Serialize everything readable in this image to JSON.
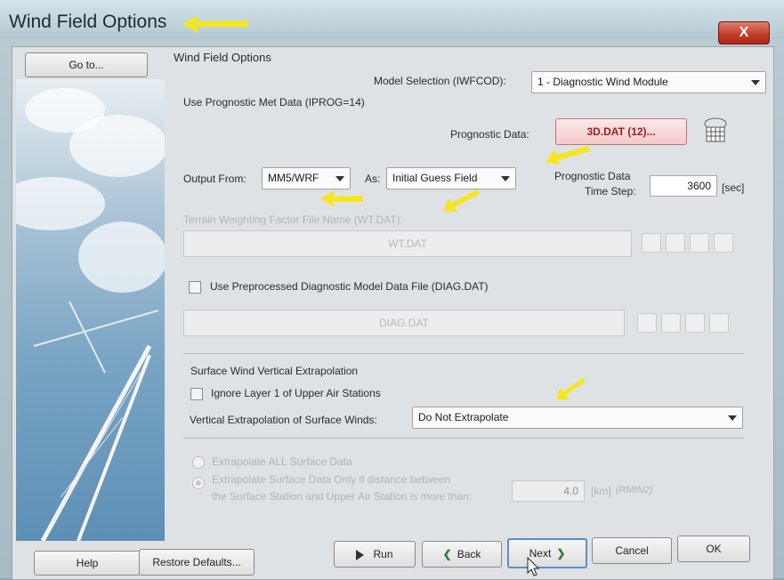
{
  "window": {
    "title": "Wind Field Options",
    "close_label": "X"
  },
  "sidebar": {
    "goto_label": "Go to..."
  },
  "panel": {
    "group_title": "Wind Field Options"
  },
  "model_selection": {
    "label": "Model Selection (IWFCOD):",
    "value": "1 - Diagnostic Wind Module"
  },
  "prognostic": {
    "section_label": "Use Prognostic Met Data (IPROG=14)",
    "data_label": "Prognostic Data:",
    "data_button": "3D.DAT (12)...",
    "output_from_label": "Output From:",
    "output_from_value": "MM5/WRF",
    "as_label": "As:",
    "as_value": "Initial Guess Field",
    "timestep_label_line1": "Prognostic Data",
    "timestep_label_line2": "Time Step:",
    "timestep_value": "3600",
    "timestep_unit": "[sec]"
  },
  "terrain": {
    "label": "Terrain Weighting Factor File Name (WT.DAT):",
    "file": "WT.DAT"
  },
  "diag": {
    "checkbox_label": "Use Preprocessed Diagnostic Model Data File (DIAG.DAT)",
    "file": "DIAG.DAT"
  },
  "surface": {
    "section_label": "Surface Wind Vertical Extrapolation",
    "ignore_label": "Ignore Layer 1 of Upper Air Stations",
    "vert_label": "Vertical Extrapolation of Surface Winds:",
    "vert_value": "Do Not Extrapolate",
    "radio_all": "Extrapolate ALL Surface Data",
    "radio_dist_line1": "Extrapolate Surface Data Only if distance between",
    "radio_dist_line2": "the Surface Station and Upper Air Station is more than:",
    "distance_value": "4.0",
    "distance_unit": "[km]",
    "distance_var": "(RMIN2)"
  },
  "footer": {
    "help": "Help",
    "restore": "Restore Defaults...",
    "run": "Run",
    "back": "Back",
    "next": "Next",
    "cancel": "Cancel",
    "ok": "OK"
  },
  "colors": {
    "arrow": "#f5e61e",
    "accent_red": "#9c1d1d",
    "close": "#c03a28"
  },
  "icons": [
    "close-icon",
    "grid-file-icon",
    "play-icon",
    "back-arrow-icon",
    "next-arrow-icon",
    "pencil-icon",
    "refresh-icon",
    "view-icon",
    "open-folder-icon",
    "annotation-arrow-icon"
  ]
}
